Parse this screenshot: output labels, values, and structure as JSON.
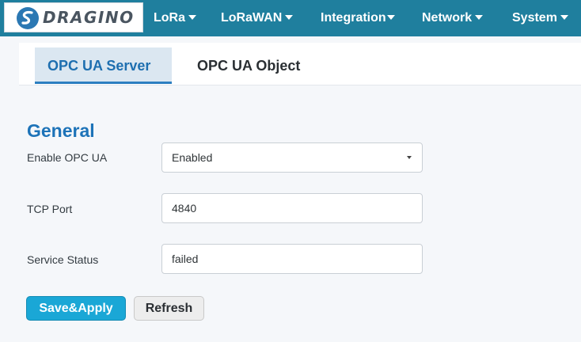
{
  "navbar": {
    "brand": "DRAGINO",
    "items": [
      {
        "label": "LoRa"
      },
      {
        "label": "LoRaWAN"
      },
      {
        "label": "Integration"
      },
      {
        "label": "Network"
      },
      {
        "label": "System"
      }
    ]
  },
  "tabs": [
    {
      "label": "OPC UA Server",
      "active": true
    },
    {
      "label": "OPC UA Object",
      "active": false
    }
  ],
  "section": {
    "title": "General",
    "fields": [
      {
        "label": "Enable OPC UA",
        "value": "Enabled",
        "type": "select"
      },
      {
        "label": "TCP Port",
        "value": "4840",
        "type": "text"
      },
      {
        "label": "Service Status",
        "value": "failed",
        "type": "text"
      }
    ]
  },
  "buttons": {
    "save_apply": "Save&Apply",
    "refresh": "Refresh"
  },
  "colors": {
    "navbar": "#1f7f9e",
    "accent": "#1d73b8",
    "primary_button": "#1aa7d6"
  }
}
